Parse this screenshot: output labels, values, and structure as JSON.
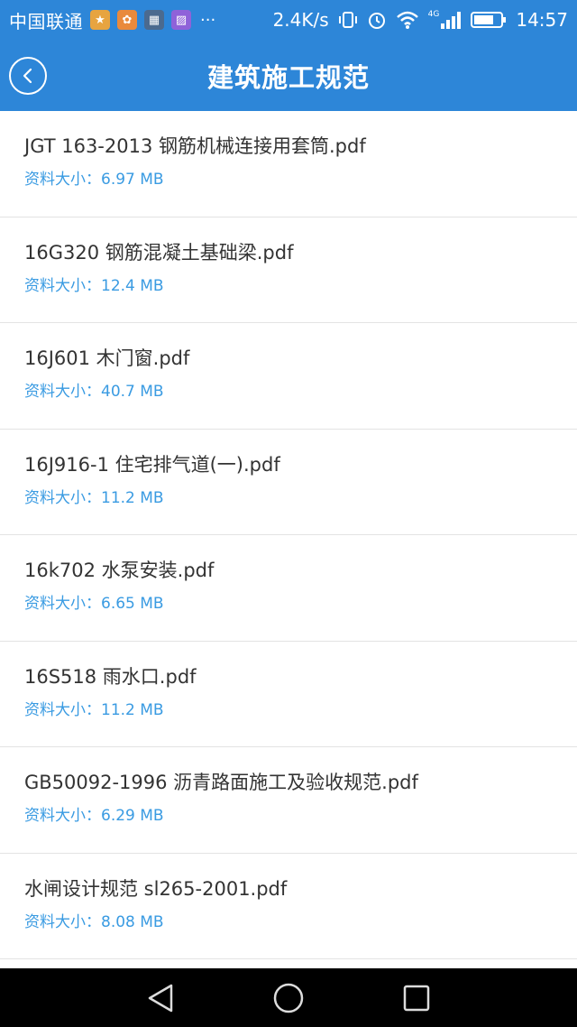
{
  "status_bar": {
    "carrier": "中国联通",
    "more": "···",
    "speed": "2.4K/s",
    "network": "4G",
    "time": "14:57"
  },
  "header": {
    "title": "建筑施工规范",
    "back_icon": "chevron-left-icon"
  },
  "colors": {
    "brand": "#2d86d8",
    "size_text": "#3a9be2",
    "name_text": "#333333"
  },
  "files": [
    {
      "name": "JGT 163-2013 钢筋机械连接用套筒.pdf",
      "size": "资料大小：6.97 MB"
    },
    {
      "name": "16G320 钢筋混凝土基础梁.pdf",
      "size": "资料大小：12.4 MB"
    },
    {
      "name": "16J601 木门窗.pdf",
      "size": "资料大小：40.7 MB"
    },
    {
      "name": "16J916-1 住宅排气道(一).pdf",
      "size": "资料大小：11.2 MB"
    },
    {
      "name": "16k702 水泵安装.pdf",
      "size": "资料大小：6.65 MB"
    },
    {
      "name": "16S518 雨水口.pdf",
      "size": "资料大小：11.2 MB"
    },
    {
      "name": "GB50092-1996 沥青路面施工及验收规范.pdf",
      "size": "资料大小：6.29 MB"
    },
    {
      "name": "水闸设计规范 sl265-2001.pdf",
      "size": "资料大小：8.08 MB"
    }
  ]
}
